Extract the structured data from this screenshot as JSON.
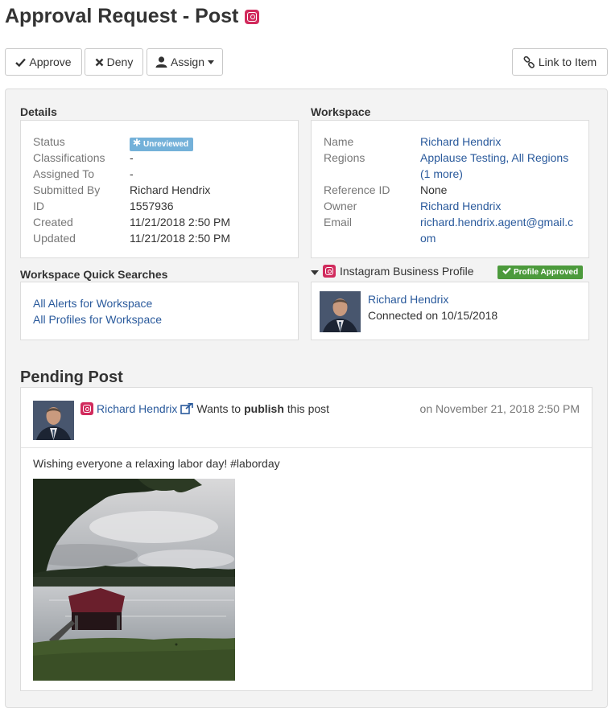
{
  "header": {
    "title": "Approval Request - Post",
    "network_icon": "instagram-icon"
  },
  "toolbar": {
    "approve": "Approve",
    "deny": "Deny",
    "assign": "Assign",
    "link": "Link to Item"
  },
  "details": {
    "title": "Details",
    "rows": [
      {
        "label": "Status",
        "value": "Unreviewed"
      },
      {
        "label": "Classifications",
        "value": "-"
      },
      {
        "label": "Assigned To",
        "value": "-"
      },
      {
        "label": "Submitted By",
        "value": "Richard Hendrix"
      },
      {
        "label": "ID",
        "value": "1557936"
      },
      {
        "label": "Created",
        "value": "11/21/2018 2:50 PM"
      },
      {
        "label": "Updated",
        "value": "11/21/2018 2:50 PM"
      }
    ]
  },
  "workspace": {
    "title": "Workspace",
    "name_label": "Name",
    "name": "Richard Hendrix",
    "regions_label": "Regions",
    "regions": "Applause Testing, All Regions",
    "regions_more": "(1 more)",
    "ref_label": "Reference ID",
    "ref": "None",
    "owner_label": "Owner",
    "owner": "Richard Hendrix",
    "email_label": "Email",
    "email_line1": "richard.hendrix.agent@gmail.c",
    "email_line2": "om"
  },
  "quick_searches": {
    "title": "Workspace Quick Searches",
    "links": [
      "All Alerts for Workspace",
      "All Profiles for Workspace"
    ]
  },
  "profile": {
    "title": "Instagram Business Profile",
    "badge": "Profile Approved",
    "name": "Richard Hendrix",
    "connected": "Connected on 10/15/2018"
  },
  "pending": {
    "title": "Pending Post",
    "author": "Richard Hendrix",
    "wants_to": "Wants to",
    "action": "publish",
    "this_post": "this post",
    "date": "on November 21, 2018 2:50 PM",
    "message": "Wishing everyone a relaxing labor day! #laborday"
  },
  "colors": {
    "link": "#2a5a9c",
    "instagram": "#d12b5d",
    "approved": "#4c9a3c",
    "unreviewed": "#74b1d9"
  }
}
